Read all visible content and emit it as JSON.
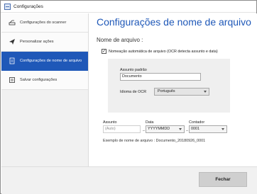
{
  "window": {
    "title": "Configurações"
  },
  "sidebar": {
    "items": [
      {
        "label": "Configurações do scanner",
        "icon": "scanner-icon",
        "active": false
      },
      {
        "label": "Personalizar ações",
        "icon": "send-icon",
        "active": false
      },
      {
        "label": "Configurações de nome de arquivo",
        "icon": "file-name-icon",
        "active": true
      },
      {
        "label": "Salvar configurações",
        "icon": "save-settings-icon",
        "active": false
      }
    ]
  },
  "main": {
    "title": "Configurações de nome de arquivo",
    "section_title": "Nome de arquivo :",
    "auto_naming": {
      "checked": true,
      "check_mark": "✓",
      "label": "Nomeação automática de arquivo (OCR detecta assunto e data)"
    },
    "default_subject": {
      "label": "Assunto padrão",
      "value": "Documento"
    },
    "ocr_language": {
      "label": "Idioma de OCR",
      "value": "Português"
    },
    "fields": {
      "subject": {
        "label": "Assunto",
        "placeholder": "(Auto)"
      },
      "date": {
        "label": "Data",
        "value": "YYYYMMDD"
      },
      "counter": {
        "label": "Contador",
        "value": "0001"
      },
      "separator": "_"
    },
    "example": "Exemplo de nome de arquivo : Documento_20180926_0001"
  },
  "footer": {
    "close_label": "Fechar"
  },
  "colors": {
    "accent": "#1f58b8",
    "sidebar_bg": "#f1f1f1",
    "panel_bg": "#efefef"
  }
}
